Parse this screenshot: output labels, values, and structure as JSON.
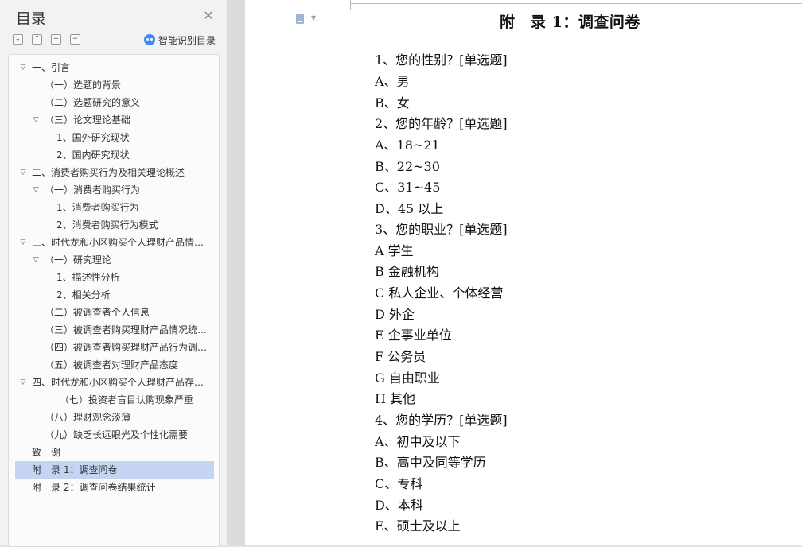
{
  "sidebar": {
    "title": "目录",
    "smart_toc_label": "智能识别目录",
    "toc": [
      {
        "label": "一、引言",
        "level": 0,
        "expand": "down"
      },
      {
        "label": "（一）选题的背景",
        "level": 1,
        "expand": ""
      },
      {
        "label": "（二）选题研究的意义",
        "level": 1,
        "expand": ""
      },
      {
        "label": "（三）论文理论基础",
        "level": 1,
        "expand": "down"
      },
      {
        "label": "1、国外研究现状",
        "level": 2,
        "expand": ""
      },
      {
        "label": "2、国内研究现状",
        "level": 2,
        "expand": ""
      },
      {
        "label": "二、消费者购买行为及相关理论概述",
        "level": 0,
        "expand": "down"
      },
      {
        "label": "（一）消费者购买行为",
        "level": 1,
        "expand": "down"
      },
      {
        "label": "1、消费者购买行为",
        "level": 2,
        "expand": ""
      },
      {
        "label": "2、消费者购买行为模式",
        "level": 2,
        "expand": ""
      },
      {
        "label": "三、时代龙和小区购买个人理财产品情况调查",
        "level": 0,
        "expand": "down"
      },
      {
        "label": "（一）研究理论",
        "level": 1,
        "expand": "down"
      },
      {
        "label": "1、描述性分析",
        "level": 2,
        "expand": ""
      },
      {
        "label": "2、相关分析",
        "level": 2,
        "expand": ""
      },
      {
        "label": "（二）被调查者个人信息",
        "level": 1,
        "expand": ""
      },
      {
        "label": "（三）被调查者购买理财产品情况统计分析",
        "level": 1,
        "expand": ""
      },
      {
        "label": "（四）被调查者购买理财产品行为调查分析",
        "level": 1,
        "expand": ""
      },
      {
        "label": "（五）被调查者对理财产品态度",
        "level": 1,
        "expand": ""
      },
      {
        "label": "四、时代龙和小区购买个人理财产品存在的问题",
        "level": 0,
        "expand": "down"
      },
      {
        "label": "（七）投资者盲目认购现象严重",
        "level": 3,
        "expand": ""
      },
      {
        "label": "（八）理财观念淡薄",
        "level": 1,
        "expand": ""
      },
      {
        "label": "（九）缺乏长远眼光及个性化需要",
        "level": 1,
        "expand": ""
      },
      {
        "label": "致　谢",
        "level": 0,
        "expand": "",
        "noindent": true
      },
      {
        "label": "附　录 1：调查问卷",
        "level": 0,
        "expand": "",
        "noindent": true,
        "selected": true
      },
      {
        "label": "附　录 2：调查问卷结果统计",
        "level": 0,
        "expand": "",
        "noindent": true
      }
    ]
  },
  "document": {
    "title": "附　录 1：调查问卷",
    "lines": [
      "1、您的性别？[单选题]",
      "A、男",
      "B、女",
      "2、您的年龄？[单选题]",
      "A、18~21",
      "B、22~30",
      "C、31~45",
      "D、45 以上",
      "3、您的职业？[单选题]",
      "A 学生",
      "B 金融机构",
      "C 私人企业、个体经营",
      "D 外企",
      "E 企事业单位",
      "F 公务员",
      "G 自由职业",
      "H 其他",
      "4、您的学历？[单选题]",
      "A、初中及以下",
      "B、高中及同等学历",
      "C、专科",
      "D、本科",
      "E、硕士及以上"
    ]
  }
}
